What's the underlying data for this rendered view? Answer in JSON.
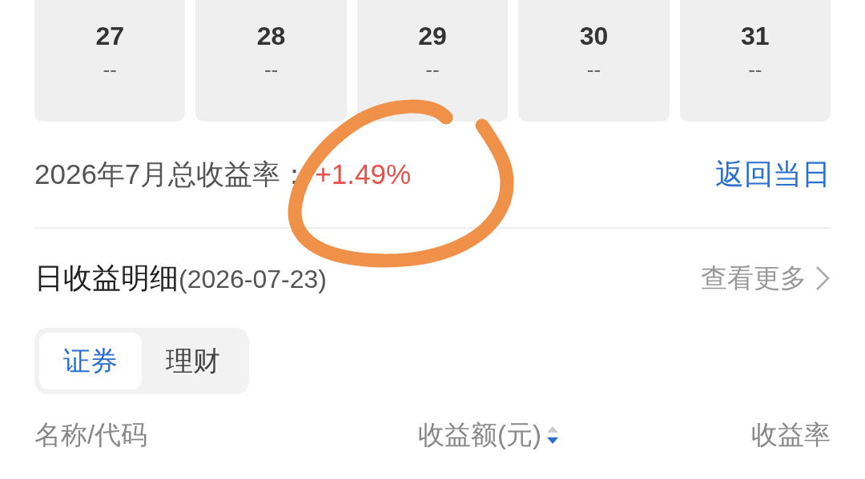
{
  "calendar_days": [
    {
      "day": "27",
      "value": "--"
    },
    {
      "day": "28",
      "value": "--"
    },
    {
      "day": "29",
      "value": "--"
    },
    {
      "day": "30",
      "value": "--"
    },
    {
      "day": "31",
      "value": "--"
    }
  ],
  "month_summary": {
    "label": "2026年7月总收益率：",
    "value": "+1.49%",
    "gain": true,
    "back_link": "返回当日"
  },
  "daily_detail": {
    "title": "日收益明细",
    "date": "(2026-07-23)",
    "more": "查看更多"
  },
  "tabs": [
    {
      "label": "证券",
      "selected": true
    },
    {
      "label": "理财",
      "selected": false
    }
  ],
  "table": {
    "columns": [
      {
        "label": "名称/代码"
      },
      {
        "label": "收益额(元)",
        "sorted_descending": true
      },
      {
        "label": "收益率"
      }
    ]
  },
  "annotation": {
    "kind": "circle"
  }
}
